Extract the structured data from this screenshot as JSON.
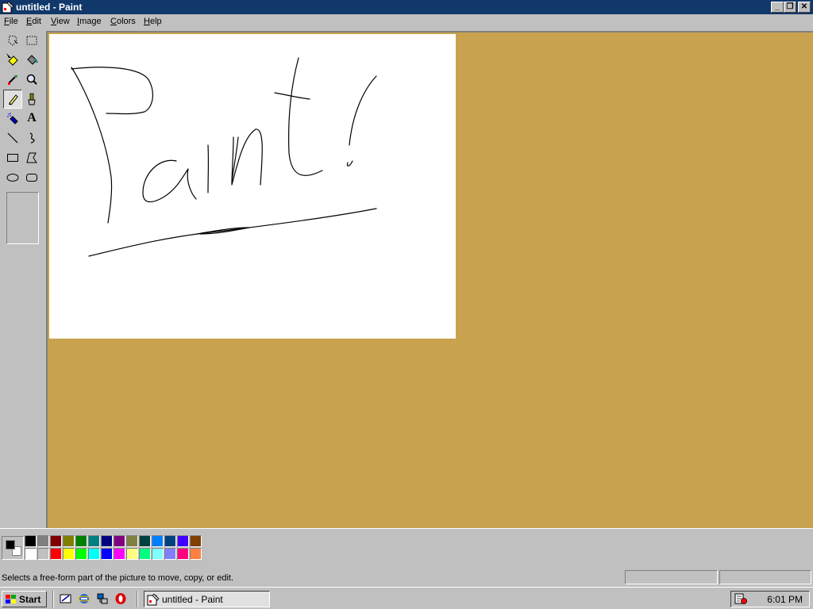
{
  "window": {
    "title": "untitled - Paint",
    "minimize_glyph": "_",
    "maximize_glyph": "❐",
    "close_glyph": "✕"
  },
  "menu": [
    {
      "label": "File",
      "accel": "F"
    },
    {
      "label": "Edit",
      "accel": "E"
    },
    {
      "label": "View",
      "accel": "V"
    },
    {
      "label": "Image",
      "accel": "I"
    },
    {
      "label": "Colors",
      "accel": "C"
    },
    {
      "label": "Help",
      "accel": "H"
    }
  ],
  "tools": [
    {
      "name": "free-form-select-icon",
      "selected": false
    },
    {
      "name": "select-icon",
      "selected": false
    },
    {
      "name": "eraser-icon",
      "selected": false
    },
    {
      "name": "fill-bucket-icon",
      "selected": false
    },
    {
      "name": "pick-color-icon",
      "selected": false
    },
    {
      "name": "magnifier-icon",
      "selected": false
    },
    {
      "name": "pencil-icon",
      "selected": true
    },
    {
      "name": "brush-icon",
      "selected": false
    },
    {
      "name": "airbrush-icon",
      "selected": false
    },
    {
      "name": "text-icon",
      "selected": false
    },
    {
      "name": "line-icon",
      "selected": false
    },
    {
      "name": "curve-icon",
      "selected": false
    },
    {
      "name": "rectangle-icon",
      "selected": false
    },
    {
      "name": "polygon-icon",
      "selected": false
    },
    {
      "name": "ellipse-icon",
      "selected": false
    },
    {
      "name": "rounded-rectangle-icon",
      "selected": false
    }
  ],
  "text_tool_glyph": "A",
  "colors": {
    "foreground": "#000000",
    "background": "#ffffff",
    "workspace": "#c9a24f",
    "titlebar": "#10386b",
    "palette_top": [
      "#000000",
      "#808080",
      "#800000",
      "#808000",
      "#008000",
      "#008080",
      "#000080",
      "#800080",
      "#808040",
      "#004040",
      "#0080ff",
      "#004080",
      "#4000ff",
      "#804000"
    ],
    "palette_bottom": [
      "#ffffff",
      "#c0c0c0",
      "#ff0000",
      "#ffff00",
      "#00ff00",
      "#00ffff",
      "#0000ff",
      "#ff00ff",
      "#ffff80",
      "#00ff80",
      "#80ffff",
      "#8080ff",
      "#ff0080",
      "#ff8040"
    ]
  },
  "status": {
    "text": "Selects a free-form part of the picture to move, copy, or edit."
  },
  "taskbar": {
    "start_label": "Start",
    "task_label": "untitled - Paint",
    "clock": "6:01 PM",
    "quick_launch": [
      "show-desktop-icon",
      "internet-explorer-icon",
      "network-icon",
      "opera-icon"
    ]
  }
}
